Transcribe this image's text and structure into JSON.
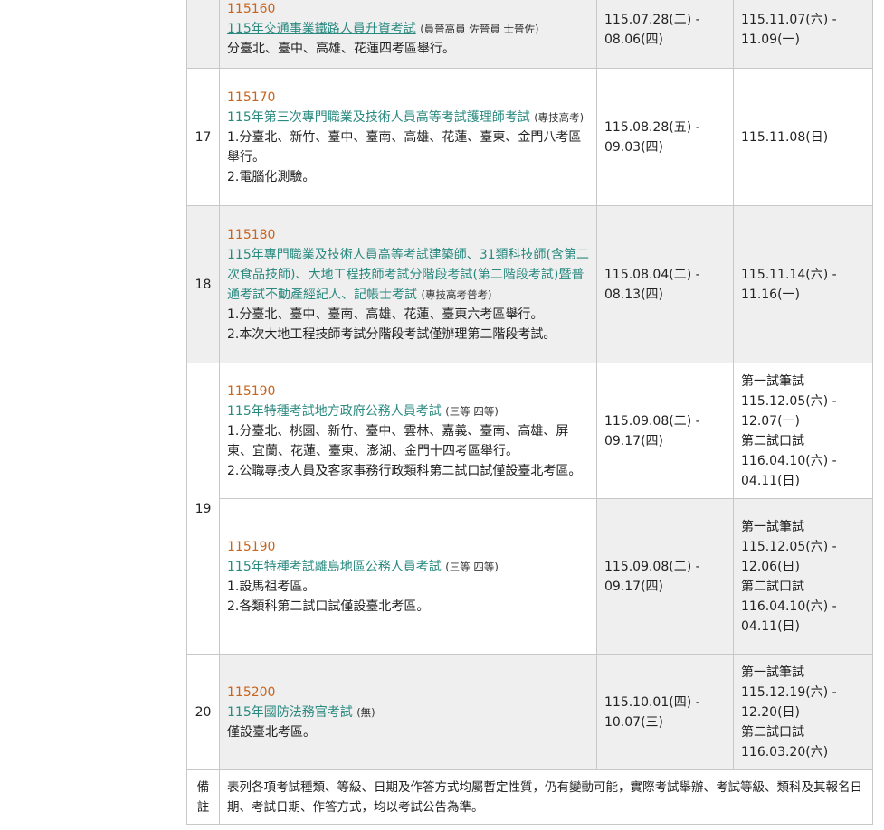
{
  "rows": [
    {
      "num": "",
      "code": "115160",
      "name": "115年交通事業鐵路人員升資考試",
      "level": "(員晉高員 佐晉員 士晉佐)",
      "notes": [
        "分臺北、臺中、高雄、花蓮四考區舉行。"
      ],
      "signup": [
        "115.07.28(二) -",
        "08.06(四)"
      ],
      "exam": [
        "115.11.07(六) -",
        "11.09(一)"
      ]
    },
    {
      "num": "17",
      "code": "115170",
      "name": "115年第三次專門職業及技術人員高等考試護理師考試",
      "level": "(專技高考)",
      "notes": [
        "1.分臺北、新竹、臺中、臺南、高雄、花蓮、臺東、金門八考區舉行。",
        "2.電腦化測驗。"
      ],
      "signup": [
        "115.08.28(五) -",
        "09.03(四)"
      ],
      "exam": [
        "115.11.08(日)"
      ]
    },
    {
      "num": "18",
      "code": "115180",
      "name": "115年專門職業及技術人員高等考試建築師、31類科技師(含第二次食品技師)、大地工程技師考試分階段考試(第二階段考試)暨普通考試不動產經紀人、記帳士考試",
      "level": "(專技高考普考)",
      "notes": [
        "1.分臺北、臺中、臺南、高雄、花蓮、臺東六考區舉行。",
        "2.本次大地工程技師考試分階段考試僅辦理第二階段考試。"
      ],
      "signup": [
        "115.08.04(二) -",
        "08.13(四)"
      ],
      "exam": [
        "115.11.14(六) -",
        "11.16(一)"
      ]
    },
    {
      "num": "19",
      "code": "115190",
      "name": "115年特種考試地方政府公務人員考試",
      "level": "(三等 四等)",
      "notes": [
        "1.分臺北、桃園、新竹、臺中、雲林、嘉義、臺南、高雄、屏東、宜蘭、花蓮、臺東、澎湖、金門十四考區舉行。",
        "2.公職專技人員及客家事務行政類科第二試口試僅設臺北考區。"
      ],
      "signup": [
        "115.09.08(二) -",
        "09.17(四)"
      ],
      "exam": [
        "第一試筆試",
        "115.12.05(六) -",
        "12.07(一)",
        "第二試口試",
        "116.04.10(六) -",
        "04.11(日)"
      ]
    },
    {
      "num": "",
      "code": "115190",
      "name": "115年特種考試離島地區公務人員考試",
      "level": "(三等 四等)",
      "notes": [
        "1.設馬祖考區。",
        "2.各類科第二試口試僅設臺北考區。"
      ],
      "signup": [
        "115.09.08(二) -",
        "09.17(四)"
      ],
      "exam": [
        "第一試筆試",
        "115.12.05(六) -",
        "12.06(日)",
        "第二試口試",
        "116.04.10(六) -",
        "04.11(日)"
      ]
    },
    {
      "num": "20",
      "code": "115200",
      "name": "115年國防法務官考試",
      "level": "(無)",
      "notes": [
        "僅設臺北考區。"
      ],
      "signup": [
        "115.10.01(四) -",
        "10.07(三)"
      ],
      "exam": [
        "第一試筆試",
        "115.12.19(六) -",
        "12.20(日)",
        "第二試口試",
        "116.03.20(六)"
      ]
    }
  ],
  "footer": {
    "label": "備註",
    "text": "表列各項考試種類、等級、日期及作答方式均屬暫定性質，仍有變動可能，實際考試舉辦、考試等級、類科及其報名日期、考試日期、作答方式，均以考試公告為準。"
  }
}
